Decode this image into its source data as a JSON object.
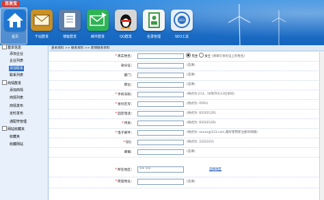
{
  "app": {
    "title": "百发宝"
  },
  "colors": {
    "banner": "#1d6fc9",
    "sidebar_bg": "#e8f1fb",
    "selected": "#2d6cc0",
    "required": "#e00000",
    "link": "#0645ad"
  },
  "toolbar": {
    "items": [
      {
        "label": "首页",
        "icon": "home-icon",
        "color": "#1f76d2"
      },
      {
        "label": "千站群发",
        "icon": "envelope-icon",
        "color": "#c99024"
      },
      {
        "label": "博客群发",
        "icon": "document-icon",
        "color": "#5f7fa8"
      },
      {
        "label": "邮件群发",
        "icon": "mail-send-icon",
        "color": "#2fb455"
      },
      {
        "label": "QQ群发",
        "icon": "qq-penguin-icon",
        "color": "#d7d7d7"
      },
      {
        "label": "名录管理",
        "icon": "address-book-icon",
        "color": "#3d9a45"
      },
      {
        "label": "SEO工具",
        "icon": "seo-gear-icon",
        "color": "#e5eef8"
      }
    ]
  },
  "sidebar": {
    "groups": [
      {
        "label": "基本信息",
        "items": [
          "添加企业",
          "企业列表",
          "添加联系",
          "联系列表"
        ]
      },
      {
        "label": "商情群发",
        "items": [
          "添加商情",
          "商情列表",
          "商情发布",
          "定时发布",
          "通配符管理"
        ]
      },
      {
        "label": "网站收藏夹",
        "items": [
          "收藏夹",
          "收藏网站"
        ]
      }
    ],
    "selected_item": "添加联系"
  },
  "breadcrumb": "基本资料 >> 联系资料 >> 新增联系资料",
  "form": {
    "fields": [
      {
        "label": "真实姓名",
        "required": true,
        "value": "",
        "hint": ""
      },
      {
        "label": "身份证",
        "required": false,
        "value": "",
        "hint": "(选填)"
      },
      {
        "label": "部门",
        "required": false,
        "value": "",
        "hint": "(选填)"
      },
      {
        "label": "职位",
        "required": false,
        "value": "",
        "hint": "(选填)"
      },
      {
        "label": "手机号码",
        "required": true,
        "value": "",
        "hint": "(格式为:213，18等开头11位号码)"
      },
      {
        "label": "省份区号",
        "required": true,
        "value": "",
        "hint": "(格式为: 0591)"
      },
      {
        "label": "固定电话",
        "required": true,
        "value": "",
        "hint": "(格式为: 83102126)"
      },
      {
        "label": "传真",
        "required": true,
        "value": "",
        "hint": "(格式为: 83102126)"
      },
      {
        "label": "电子邮件",
        "required": true,
        "value": "",
        "hint": "(格式为: xxxxx@123.com,最好使用新注册的邮箱)"
      },
      {
        "label": "QQ",
        "required": true,
        "value": "",
        "hint": "(格式为: 2222222)"
      },
      {
        "label": "邮编",
        "required": false,
        "value": "",
        "hint": "(选填)"
      },
      {
        "label": "所在地区",
        "required": true,
        "value": ">> >>",
        "hint": "",
        "link": "选择地区"
      },
      {
        "label": "街道地址",
        "required": true,
        "value": "",
        "hint": "(选填)"
      }
    ],
    "gender": {
      "options": [
        "先生",
        "女士"
      ],
      "selected": "先生",
      "note": "(请填写身份证上的姓名)"
    }
  }
}
